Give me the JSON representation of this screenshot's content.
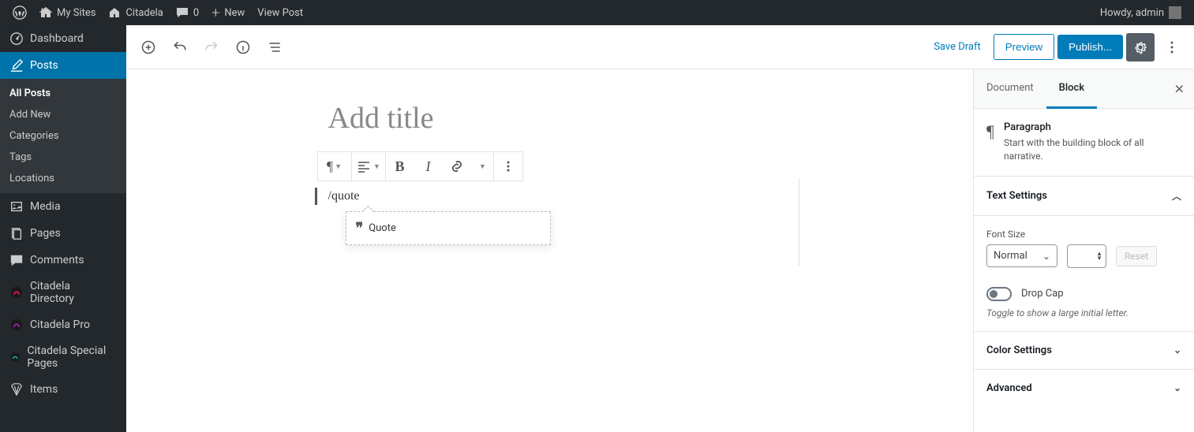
{
  "adminbar": {
    "my_sites": "My Sites",
    "site_name": "Citadela",
    "comments_count": "0",
    "new": "New",
    "view_post": "View Post",
    "greeting": "Howdy, admin"
  },
  "sidebar": {
    "dashboard": "Dashboard",
    "posts": "Posts",
    "posts_sub": {
      "all_posts": "All Posts",
      "add_new": "Add New",
      "categories": "Categories",
      "tags": "Tags",
      "locations": "Locations"
    },
    "media": "Media",
    "pages": "Pages",
    "comments": "Comments",
    "citadela_directory": "Citadela Directory",
    "citadela_pro": "Citadela Pro",
    "citadela_special": "Citadela Special Pages",
    "items": "Items"
  },
  "editor_top": {
    "save_draft": "Save Draft",
    "preview": "Preview",
    "publish": "Publish..."
  },
  "canvas": {
    "title_placeholder": "Add title",
    "slash_text": "/quote",
    "autocomplete": {
      "quote": "Quote"
    }
  },
  "settings": {
    "tab_document": "Document",
    "tab_block": "Block",
    "block_name": "Paragraph",
    "block_desc": "Start with the building block of all narrative.",
    "text_settings": "Text Settings",
    "font_size_label": "Font Size",
    "font_size_value": "Normal",
    "reset": "Reset",
    "drop_cap": "Drop Cap",
    "drop_cap_hint": "Toggle to show a large initial letter.",
    "color_settings": "Color Settings",
    "advanced": "Advanced"
  }
}
